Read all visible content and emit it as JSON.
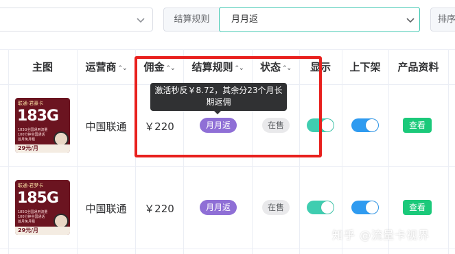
{
  "filters": {
    "settlement_label": "结算规则",
    "settlement_value": "月月返",
    "sort_label": "排序"
  },
  "table": {
    "headers": [
      "主图",
      "运营商",
      "佣金",
      "结算规则",
      "状态",
      "显示",
      "上下架",
      "产品资料"
    ],
    "rows": [
      {
        "image": {
          "tag": "联通·君豪卡",
          "data": "183G",
          "line1": "183G全国通用流量",
          "line2": "100分钟全国通话",
          "line3": "首月免月租",
          "price": "29元/月"
        },
        "operator": "中国联通",
        "commission": "￥220",
        "rule": "月月返",
        "status": "在售",
        "show": true,
        "listed": true,
        "action": "查看"
      },
      {
        "image": {
          "tag": "联通·君梦卡",
          "data": "185G",
          "line1": "185G全国通用流量",
          "line2": "100分钟全国通话",
          "line3": "首月免月租",
          "price": "29元/月"
        },
        "operator": "中国联通",
        "commission": "￥220",
        "rule": "月月返",
        "status": "在售",
        "show": true,
        "listed": true,
        "action": "查看"
      }
    ]
  },
  "tooltip": {
    "text": "激活秒反￥8.72，其余分23个月长期返佣"
  },
  "watermark": "知乎 @流量卡视界",
  "colors": {
    "accent": "#45c9b3",
    "switch_show": "#3fcdb0",
    "switch_listed": "#2f9bf0",
    "purple_tag": "#8f6fd6",
    "view_button": "#1bc97a",
    "highlight": "#e8201d"
  }
}
